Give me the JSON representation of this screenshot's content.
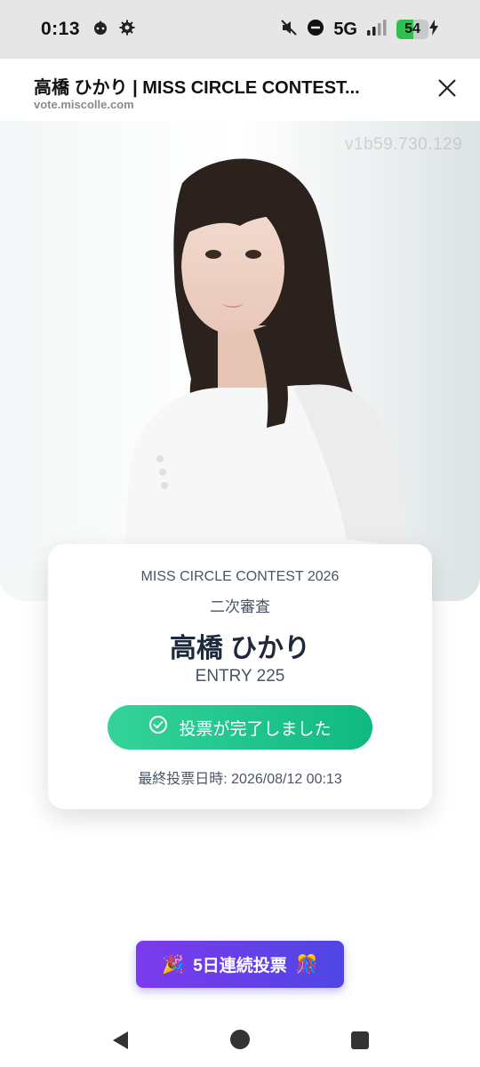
{
  "status_bar": {
    "time": "0:13",
    "network": "5G",
    "battery_level": 54,
    "battery_text": "54"
  },
  "browser": {
    "title": "高橋 ひかり | MISS CIRCLE CONTEST...",
    "url": "vote.miscolle.com"
  },
  "hero": {
    "watermark": "v1b59.730.129"
  },
  "entry_card": {
    "contest": "MISS CIRCLE CONTEST 2026",
    "stage": "二次審査",
    "name": "高橋 ひかり",
    "entry": "ENTRY 225",
    "vote_button_label": "投票が完了しました",
    "last_vote": "最終投票日時: 2026/08/12 00:13"
  },
  "streak": {
    "label": "5日連続投票",
    "emoji_left": "🎉",
    "emoji_right": "🎊"
  },
  "colors": {
    "vote_button": "#10b981",
    "streak_button_start": "#7c3aed",
    "streak_button_end": "#4f46e5",
    "battery_fill": "#2ec04f"
  },
  "icons": {
    "status": [
      "android-head-icon",
      "gear-icon",
      "mute-icon",
      "do-not-disturb-icon",
      "signal-icon",
      "battery-icon",
      "charging-icon"
    ],
    "header": [
      "close-icon"
    ],
    "card": [
      "check-circle-icon"
    ],
    "nav": [
      "back-icon",
      "home-icon",
      "recents-icon"
    ]
  }
}
